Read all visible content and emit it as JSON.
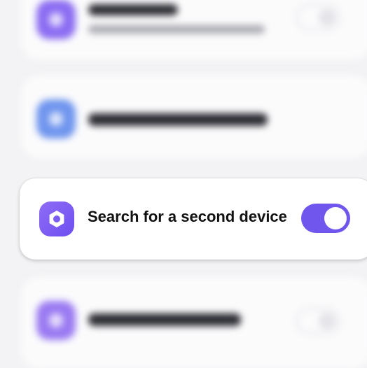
{
  "focused_setting": {
    "title": "Search for a second device",
    "icon": "gear-icon",
    "toggle_state": "on",
    "accent_color": "#7156ee"
  }
}
